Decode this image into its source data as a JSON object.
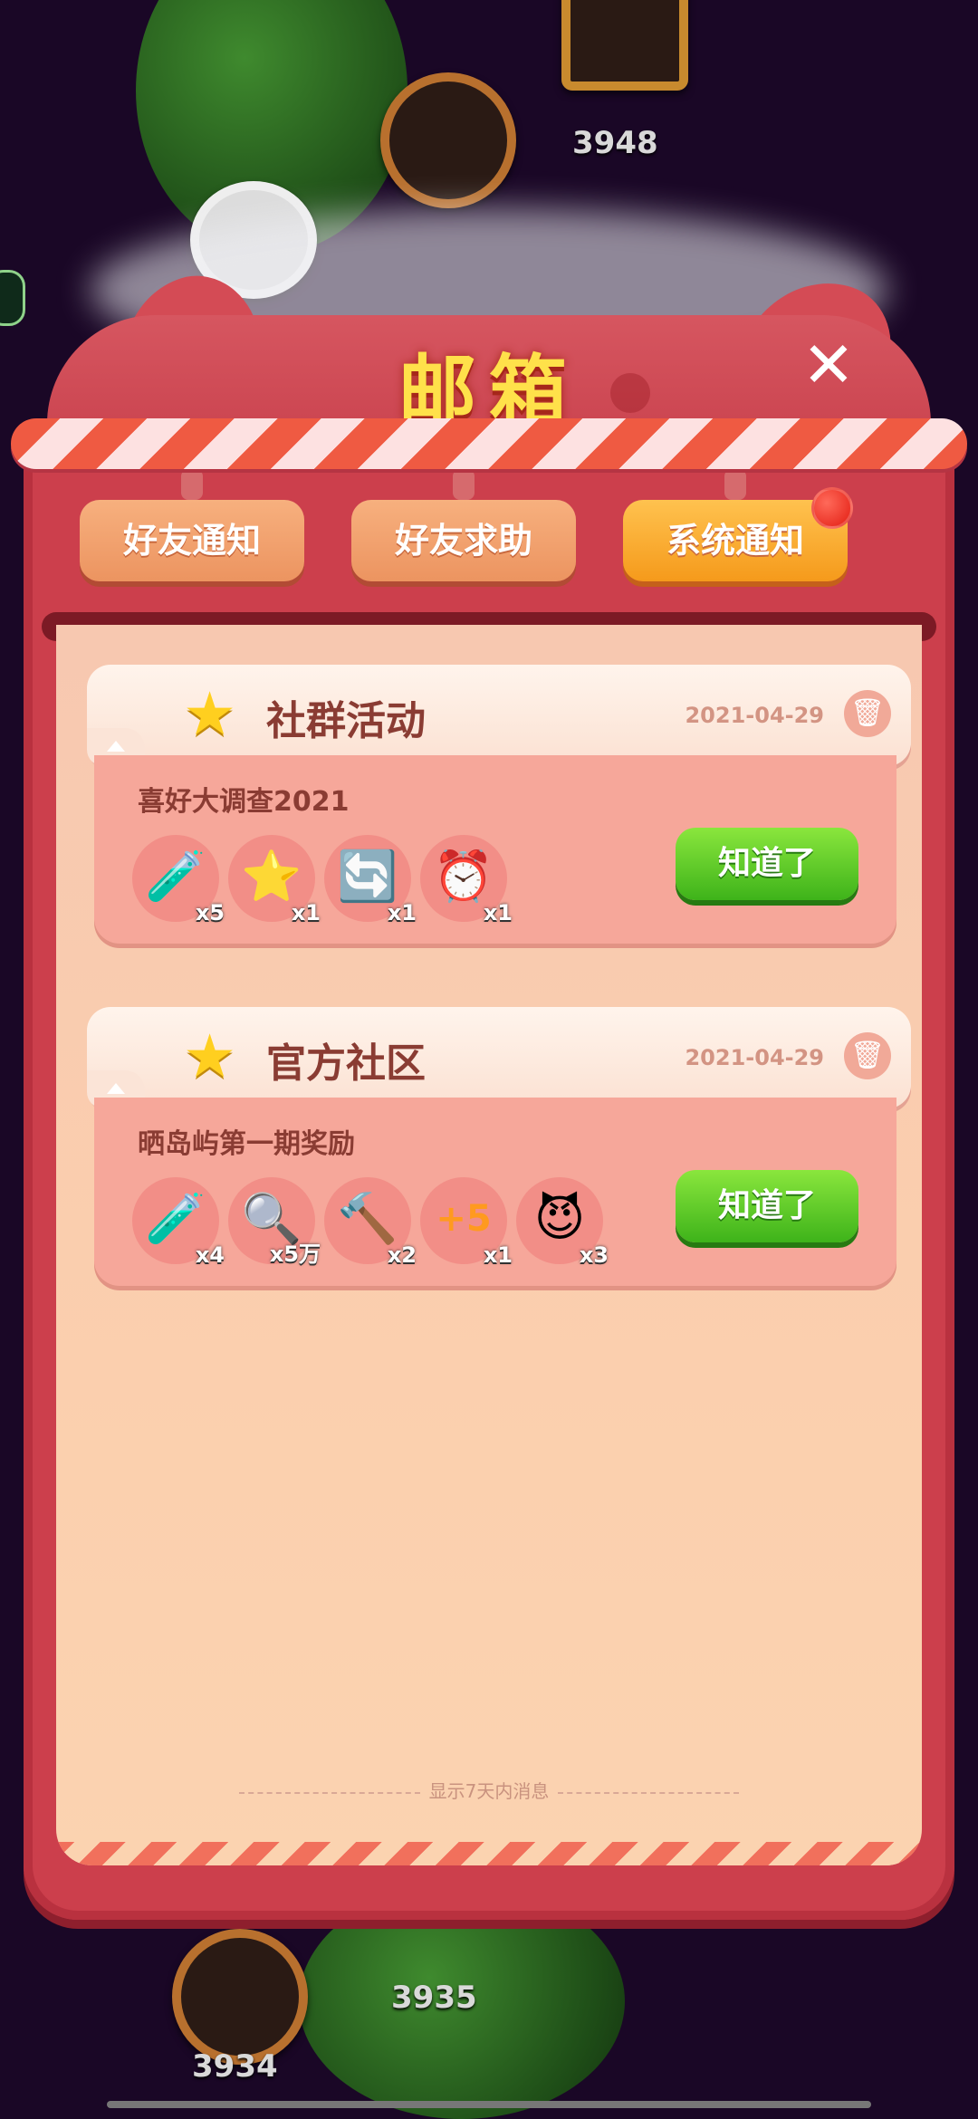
{
  "background": {
    "levels": [
      "3948",
      "3935",
      "3934"
    ],
    "colors": {
      "bg": "#1a0726",
      "vine": "#2f6b22"
    }
  },
  "mailbox": {
    "title": "邮箱",
    "close_icon": "close-icon",
    "tabs": [
      {
        "label": "好友通知",
        "active": false,
        "badge": false
      },
      {
        "label": "好友求助",
        "active": false,
        "badge": false
      },
      {
        "label": "系统通知",
        "active": true,
        "badge": true
      }
    ],
    "messages": [
      {
        "category": "社群活动",
        "date": "2021-04-29",
        "subtitle": "喜好大调查2021",
        "rewards": [
          {
            "icon": "potion-bottle-icon",
            "qty": "x5"
          },
          {
            "icon": "magic-wand-icon",
            "qty": "x1"
          },
          {
            "icon": "shuffle-board-icon",
            "qty": "x1"
          },
          {
            "icon": "clock-icon",
            "qty": "x1"
          }
        ],
        "button": "知道了"
      },
      {
        "category": "官方社区",
        "date": "2021-04-29",
        "subtitle": "晒岛屿第一期奖励",
        "rewards": [
          {
            "icon": "blue-potion-icon",
            "qty": "x4"
          },
          {
            "icon": "coin-icon",
            "qty": "x5万"
          },
          {
            "icon": "hammer-icon",
            "qty": "x2"
          },
          {
            "icon": "plus-five-icon",
            "qty": "x1"
          },
          {
            "icon": "pet-swap-icon",
            "qty": "x3"
          }
        ],
        "button": "知道了"
      }
    ],
    "footer": "显示7天内消息",
    "colors": {
      "frame": "#cc3f4c",
      "title": "#ffe14a",
      "button": "#4cbc1f",
      "active_tab": "#f8a933"
    }
  }
}
